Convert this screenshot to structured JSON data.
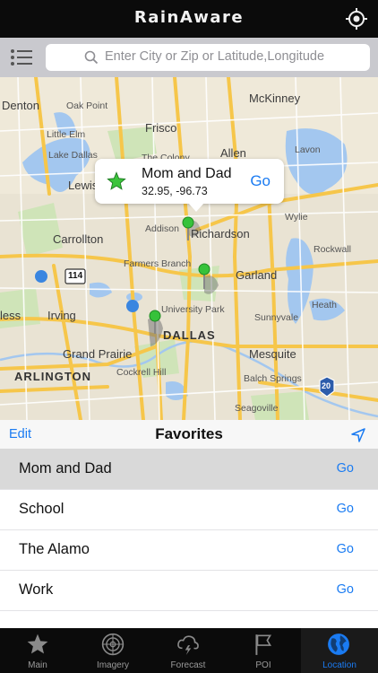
{
  "header": {
    "title": "RainAware",
    "locate_icon": "crosshair-icon"
  },
  "search": {
    "placeholder": "Enter City or Zip or Latitude,Longitude",
    "menu_icon": "list-menu-icon",
    "search_icon": "magnifier-icon"
  },
  "map": {
    "labels": {
      "denton": "Denton",
      "oak_point": "Oak Point",
      "mckinney": "McKinney",
      "frisco": "Frisco",
      "little_elm": "Little Elm",
      "lake_dallas": "Lake Dallas",
      "the_colony": "The Colony",
      "allen": "Allen",
      "lavon": "Lavon",
      "lewisville": "Lewis",
      "wylie": "Wylie",
      "addison": "Addison",
      "richardson": "Richardson",
      "carrollton": "Carrollton",
      "rockwall": "Rockwall",
      "farmers_branch": "Farmers Branch",
      "garland": "Garland",
      "university_park": "University Park",
      "sunnyvale": "Sunnyvale",
      "euless": "less",
      "irving": "Irving",
      "dallas": "DALLAS",
      "heath": "Heath",
      "grand_prairie": "Grand Prairie",
      "mesquite": "Mesquite",
      "cockrell_hill": "Cockrell Hill",
      "arlington": "ARLINGTON",
      "balch_springs": "Balch Springs",
      "seagoville": "Seagoville",
      "hwy_114": "114",
      "hwy_20": "20"
    },
    "callout": {
      "name": "Mom and Dad",
      "coords": "32.95, -96.73",
      "go": "Go",
      "star_color": "#3cc43c"
    }
  },
  "favorites": {
    "edit": "Edit",
    "title": "Favorites",
    "items": [
      {
        "name": "Mom and Dad",
        "go": "Go",
        "selected": true
      },
      {
        "name": "School",
        "go": "Go",
        "selected": false
      },
      {
        "name": "The Alamo",
        "go": "Go",
        "selected": false
      },
      {
        "name": "Work",
        "go": "Go",
        "selected": false
      }
    ]
  },
  "tabs": [
    {
      "label": "Main",
      "icon": "star-icon",
      "active": false
    },
    {
      "label": "Imagery",
      "icon": "radar-icon",
      "active": false
    },
    {
      "label": "Forecast",
      "icon": "storm-cloud-icon",
      "active": false
    },
    {
      "label": "POI",
      "icon": "flag-icon",
      "active": false
    },
    {
      "label": "Location",
      "icon": "globe-icon",
      "active": true
    }
  ],
  "colors": {
    "accent": "#1a7bf2",
    "header_bg": "#0b0b0b",
    "pin": "#36c23a",
    "water": "#9fc4ee",
    "park": "#c8e2b0",
    "road": "#f7c94c"
  }
}
